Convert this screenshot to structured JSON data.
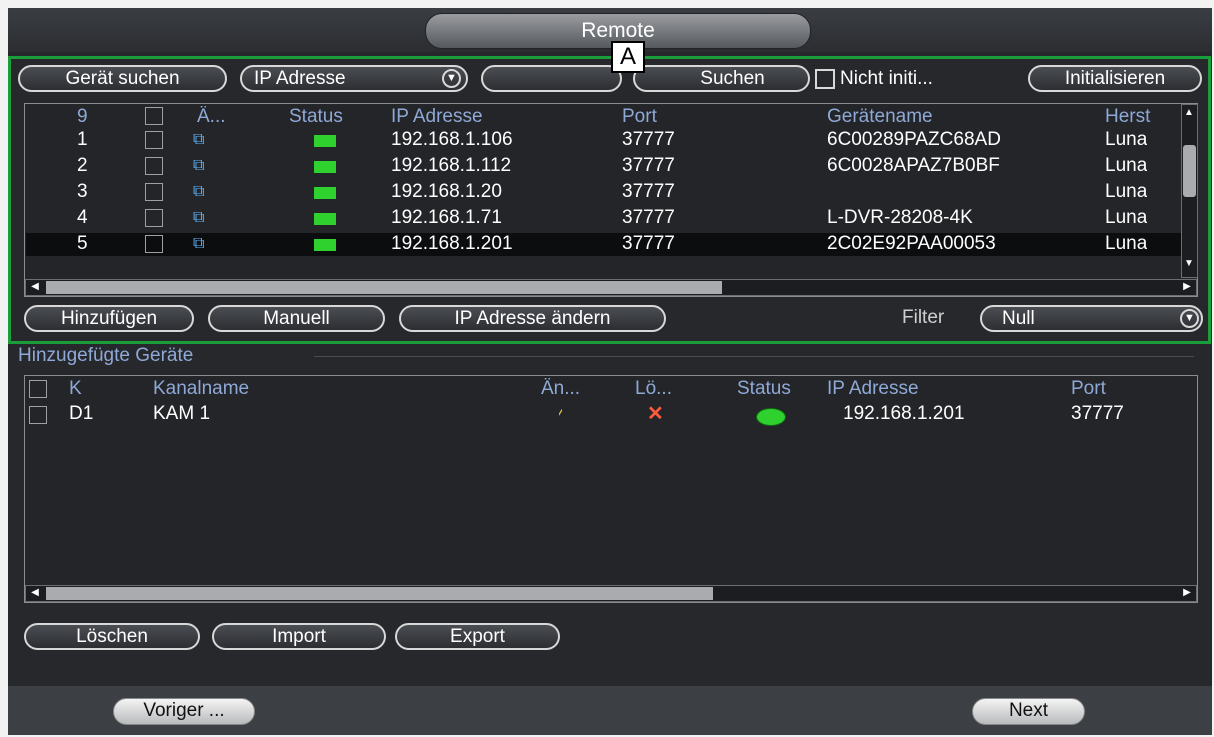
{
  "title": "Remote",
  "annotation": "A",
  "search": {
    "device_search_label": "Gerät suchen",
    "type_select_value": "IP Adresse",
    "search_input_value": "",
    "search_button_label": "Suchen",
    "uninit_label": "Nicht initi...",
    "initialize_label": "Initialisieren"
  },
  "found": {
    "headers": [
      "9",
      "Ä...",
      "Status",
      "IP Adresse",
      "Port",
      "Gerätename",
      "Herst"
    ],
    "rows": [
      {
        "n": "1",
        "ip": "192.168.1.106",
        "port": "37777",
        "name": "6C00289PAZC68AD",
        "mfr": "Luna"
      },
      {
        "n": "2",
        "ip": "192.168.1.112",
        "port": "37777",
        "name": "6C0028APAZ7B0BF",
        "mfr": "Luna"
      },
      {
        "n": "3",
        "ip": "192.168.1.20",
        "port": "37777",
        "name": "",
        "mfr": "Luna"
      },
      {
        "n": "4",
        "ip": "192.168.1.71",
        "port": "37777",
        "name": "L-DVR-28208-4K",
        "mfr": "Luna"
      },
      {
        "n": "5",
        "ip": "192.168.1.201",
        "port": "37777",
        "name": "2C02E92PAA00053",
        "mfr": "Luna"
      }
    ],
    "selected_row": 5
  },
  "actions": {
    "add_label": "Hinzufügen",
    "manual_label": "Manuell",
    "change_ip_label": "IP Adresse ändern",
    "filter_label": "Filter",
    "filter_value": "Null"
  },
  "added": {
    "section_title": "Hinzugefügte Geräte",
    "headers": [
      "K",
      "Kanalname",
      "Än...",
      "Lö...",
      "Status",
      "IP Adresse",
      "Port"
    ],
    "rows": [
      {
        "k": "D1",
        "name": "KAM 1",
        "ip": "192.168.1.201",
        "port": "37777"
      }
    ]
  },
  "bottom_buttons": {
    "delete": "Löschen",
    "import": "Import",
    "export": "Export"
  },
  "footer": {
    "prev": "Voriger ...",
    "next": "Next"
  },
  "colors": {
    "highlight": "#1a9d3b",
    "status_ok": "#2fd12f",
    "delete_x": "#ff5a3c",
    "edit": "#e8c840"
  }
}
